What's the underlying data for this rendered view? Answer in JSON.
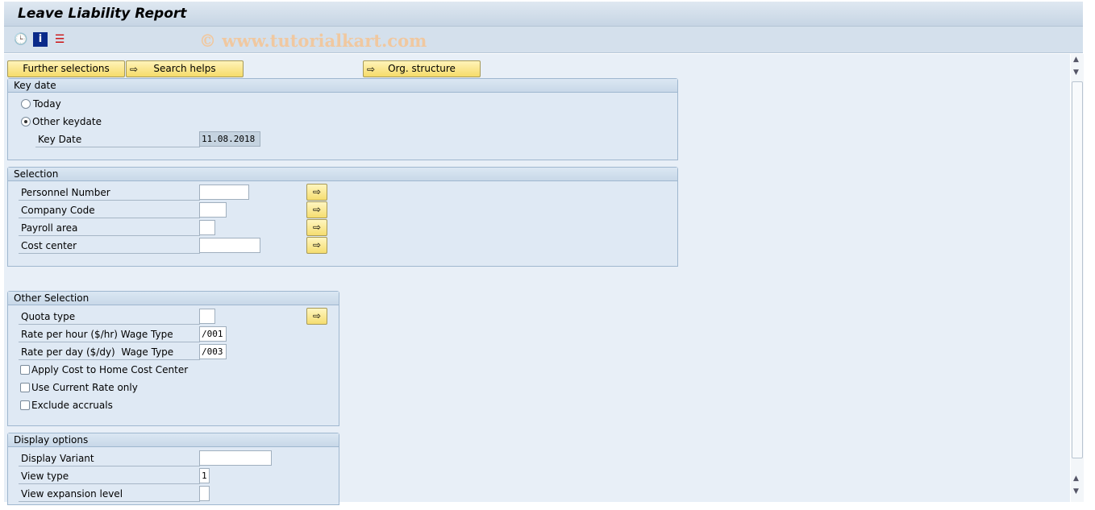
{
  "title": "Leave Liability Report",
  "watermark": "© www.tutorialkart.com",
  "toolbar": {
    "icons": [
      "execute-clock-icon",
      "info-icon",
      "selection-screen-icon"
    ]
  },
  "buttons": {
    "further": "Further selections",
    "search": "Search helps",
    "org": "Org. structure"
  },
  "key_date": {
    "title": "Key date",
    "today": "Today",
    "other": "Other keydate",
    "key_date_label": "Key Date",
    "key_date_value": "11.08.2018",
    "selected": "other"
  },
  "selection": {
    "title": "Selection",
    "fields": [
      {
        "label": "Personnel Number",
        "value": ""
      },
      {
        "label": "Company Code",
        "value": ""
      },
      {
        "label": "Payroll area",
        "value": ""
      },
      {
        "label": "Cost center",
        "value": ""
      }
    ]
  },
  "other_selection": {
    "title": "Other Selection",
    "quota": "Quota type",
    "quota_value": "",
    "rate_hour": "Rate per hour ($/hr) Wage Type",
    "rate_hour_value": "/001",
    "rate_day": "Rate per day ($/dy)  Wage Type",
    "rate_day_value": "/003",
    "checks": [
      {
        "label": "Apply Cost to Home Cost Center",
        "checked": false
      },
      {
        "label": "Use Current Rate only",
        "checked": false
      },
      {
        "label": "Exclude accruals",
        "checked": false
      }
    ]
  },
  "display": {
    "title": "Display options",
    "variant": "Display Variant",
    "variant_value": "",
    "view_type": "View type",
    "view_type_value": "1",
    "expansion": "View expansion level",
    "expansion_value": ""
  }
}
